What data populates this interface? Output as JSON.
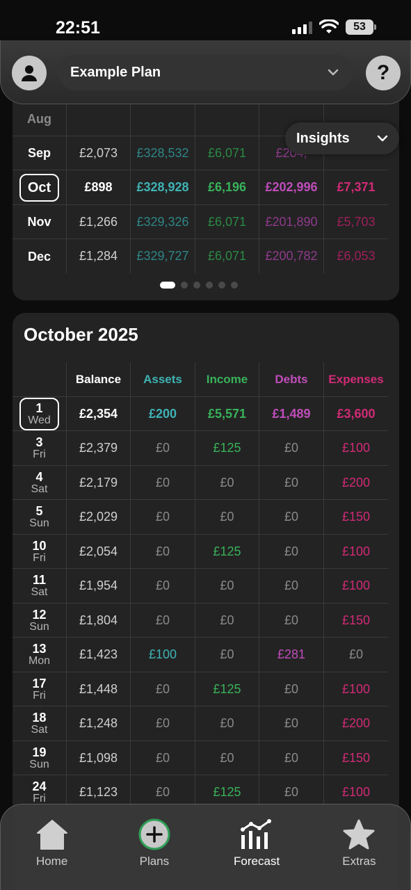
{
  "status": {
    "time": "22:51",
    "battery": "53"
  },
  "header": {
    "plan_name": "Example Plan"
  },
  "insights": {
    "label": "Insights"
  },
  "month_table": {
    "rows": [
      {
        "label": "Aug",
        "balance": "",
        "assets": "",
        "income": "",
        "debts": "",
        "expenses": ""
      },
      {
        "label": "Sep",
        "balance": "£2,073",
        "assets": "£328,532",
        "income": "£6,071",
        "debts": "£204,",
        "expenses": ""
      },
      {
        "label": "Oct",
        "balance": "£898",
        "assets": "£328,928",
        "income": "£6,196",
        "debts": "£202,996",
        "expenses": "£7,371"
      },
      {
        "label": "Nov",
        "balance": "£1,266",
        "assets": "£329,326",
        "income": "£6,071",
        "debts": "£201,890",
        "expenses": "£5,703"
      },
      {
        "label": "Dec",
        "balance": "£1,284",
        "assets": "£329,727",
        "income": "£6,071",
        "debts": "£200,782",
        "expenses": "£6,053"
      }
    ],
    "page_count": 6,
    "active_page": 1
  },
  "day_table": {
    "title": "October 2025",
    "headers": {
      "balance": "Balance",
      "assets": "Assets",
      "income": "Income",
      "debts": "Debts",
      "expenses": "Expenses"
    },
    "rows": [
      {
        "day": "1",
        "weekday": "Wed",
        "balance": "£2,354",
        "assets": "£200",
        "income": "£5,571",
        "debts": "£1,489",
        "expenses": "£3,600"
      },
      {
        "day": "3",
        "weekday": "Fri",
        "balance": "£2,379",
        "assets": "£0",
        "income": "£125",
        "debts": "£0",
        "expenses": "£100"
      },
      {
        "day": "4",
        "weekday": "Sat",
        "balance": "£2,179",
        "assets": "£0",
        "income": "£0",
        "debts": "£0",
        "expenses": "£200"
      },
      {
        "day": "5",
        "weekday": "Sun",
        "balance": "£2,029",
        "assets": "£0",
        "income": "£0",
        "debts": "£0",
        "expenses": "£150"
      },
      {
        "day": "10",
        "weekday": "Fri",
        "balance": "£2,054",
        "assets": "£0",
        "income": "£125",
        "debts": "£0",
        "expenses": "£100"
      },
      {
        "day": "11",
        "weekday": "Sat",
        "balance": "£1,954",
        "assets": "£0",
        "income": "£0",
        "debts": "£0",
        "expenses": "£100"
      },
      {
        "day": "12",
        "weekday": "Sun",
        "balance": "£1,804",
        "assets": "£0",
        "income": "£0",
        "debts": "£0",
        "expenses": "£150"
      },
      {
        "day": "13",
        "weekday": "Mon",
        "balance": "£1,423",
        "assets": "£100",
        "income": "£0",
        "debts": "£281",
        "expenses": "£0"
      },
      {
        "day": "17",
        "weekday": "Fri",
        "balance": "£1,448",
        "assets": "£0",
        "income": "£125",
        "debts": "£0",
        "expenses": "£100"
      },
      {
        "day": "18",
        "weekday": "Sat",
        "balance": "£1,248",
        "assets": "£0",
        "income": "£0",
        "debts": "£0",
        "expenses": "£200"
      },
      {
        "day": "19",
        "weekday": "Sun",
        "balance": "£1,098",
        "assets": "£0",
        "income": "£0",
        "debts": "£0",
        "expenses": "£150"
      },
      {
        "day": "24",
        "weekday": "Fri",
        "balance": "£1,123",
        "assets": "£0",
        "income": "£125",
        "debts": "£0",
        "expenses": "£100"
      }
    ]
  },
  "nav": {
    "items": [
      {
        "label": "Home",
        "icon": "home-icon"
      },
      {
        "label": "Plans",
        "icon": "plus-circle-icon"
      },
      {
        "label": "Forecast",
        "icon": "forecast-chart-icon"
      },
      {
        "label": "Extras",
        "icon": "star-icon"
      }
    ],
    "active": "Forecast"
  },
  "colors": {
    "assets": "#3fb3b5",
    "income": "#38b25a",
    "debts": "#c04dbb",
    "expenses": "#d12a76"
  }
}
